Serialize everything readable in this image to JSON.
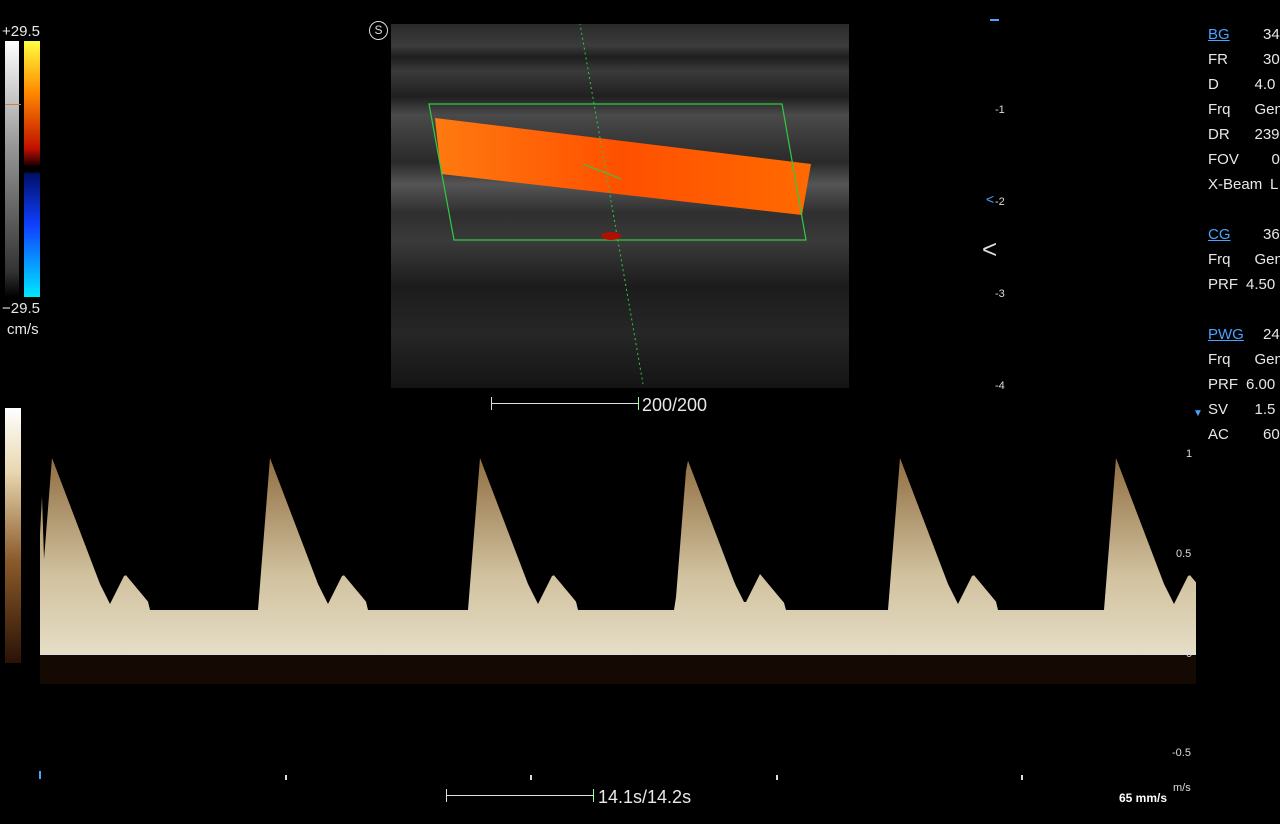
{
  "color_scale": {
    "max": "+29.5",
    "min": "−29.5",
    "unit": "cm/s"
  },
  "scale_label_bmode": "200/200",
  "scale_label_time": "14.1s/14.2s",
  "depth_ticks": [
    "-1",
    "-2",
    "-3",
    "-4"
  ],
  "velocity_ticks": [
    "1",
    "0.5",
    "0",
    "-0.5"
  ],
  "velocity_unit": "m/s",
  "sweep_speed": "65 mm/s",
  "params": [
    {
      "label": "BG",
      "value": "34",
      "link": true
    },
    {
      "label": "FR",
      "value": "30"
    },
    {
      "label": "D",
      "value": "4.0"
    },
    {
      "label": "Frq",
      "value": "Gen"
    },
    {
      "label": "DR",
      "value": "239"
    },
    {
      "label": "FOV",
      "value": "0"
    },
    {
      "label": "X-Beam",
      "value": "L"
    },
    {
      "label": "CG",
      "value": "36",
      "link": true
    },
    {
      "label": "Frq",
      "value": "Gen"
    },
    {
      "label": "PRF",
      "value": "4.50"
    },
    {
      "label": "PWG",
      "value": "24",
      "link": true
    },
    {
      "label": "Frq",
      "value": "Gen"
    },
    {
      "label": "PRF",
      "value": "6.00"
    },
    {
      "label": "SV",
      "value": "1.5"
    },
    {
      "label": "AC",
      "value": "60"
    }
  ],
  "spectrum": {
    "peak_velocity": 0.98,
    "diastolic_velocity": 0.22,
    "cycles": 6
  },
  "colors": {
    "accent": "#4aa3ff",
    "roi": "#2ecc40",
    "flow": "#ff5a00",
    "spectrum": "#e8d7b0"
  }
}
